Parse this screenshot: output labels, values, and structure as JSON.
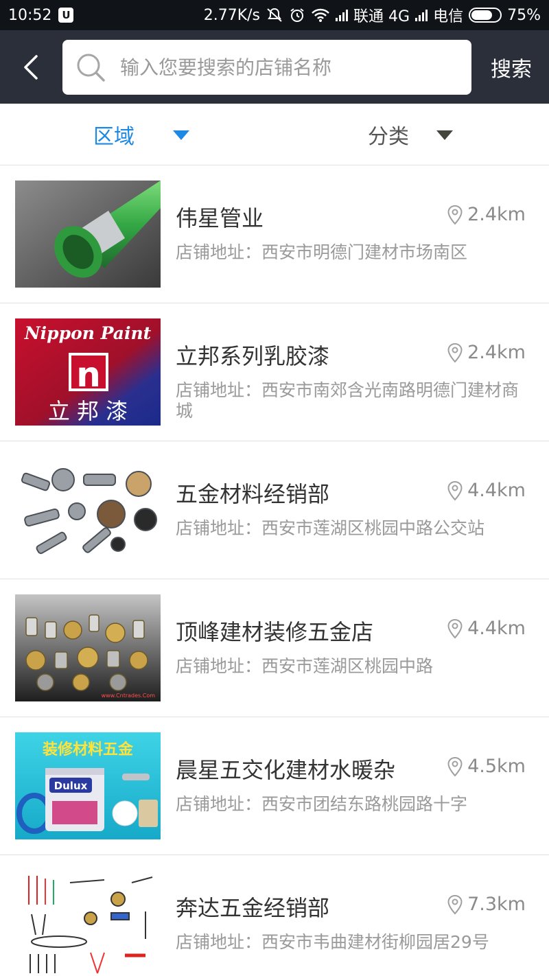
{
  "status_bar": {
    "time": "10:52",
    "app_badge": "U",
    "network_speed": "2.77K/s",
    "carrier1": "联通 4G",
    "carrier2": "电信",
    "battery": "75%",
    "battery_level": 0.75
  },
  "search": {
    "placeholder": "输入您要搜索的店铺名称",
    "button_label": "搜索"
  },
  "filters": {
    "region_label": "区域",
    "category_label": "分类",
    "active": "区域",
    "active_color": "#1e88e5"
  },
  "colors": {
    "header_bg": "#2b2f3a",
    "status_bg": "#101418"
  },
  "stores": [
    {
      "name": "伟星管业",
      "distance": "2.4km",
      "address": "店铺地址：西安市明德门建材市场南区",
      "thumb": "green-pipe-image"
    },
    {
      "name": "立邦系列乳胶漆",
      "distance": "2.4km",
      "address": "店铺地址：西安市南郊含光南路明德门建材商城",
      "thumb": "nippon-paint-logo",
      "thumb_text": {
        "brand": "Nippon Paint",
        "mark": "n",
        "cn": "立 邦 漆"
      }
    },
    {
      "name": "五金材料经销部",
      "distance": "4.4km",
      "address": "店铺地址：西安市莲湖区桃园中路公交站",
      "thumb": "hardware-parts-image"
    },
    {
      "name": "顶峰建材装修五金店",
      "distance": "4.4km",
      "address": "店铺地址：西安市莲湖区桃园中路",
      "thumb": "brass-fittings-image",
      "thumb_text": {
        "watermark": "www.Cntrades.Com"
      }
    },
    {
      "name": "晨星五交化建材水暖杂",
      "distance": "4.5km",
      "address": "店铺地址：西安市团结东路桃园路十字",
      "thumb": "decoration-materials-image",
      "thumb_text": {
        "banner": "装修材料五金",
        "brand": "Dulux"
      }
    },
    {
      "name": "奔达五金经销部",
      "distance": "7.3km",
      "address": "店铺地址：西安市韦曲建材街柳园居29号",
      "thumb": "tools-collection-image"
    }
  ]
}
